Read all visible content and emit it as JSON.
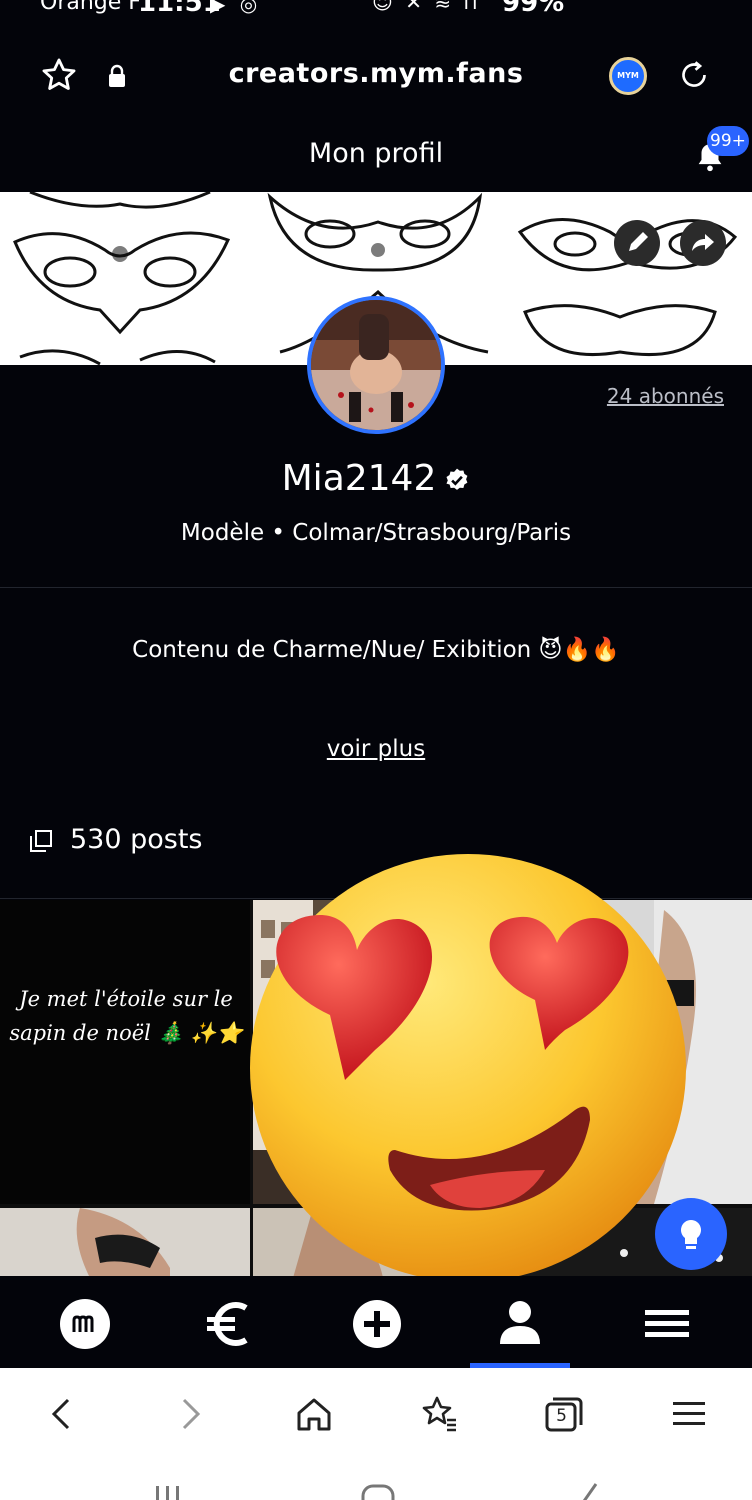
{
  "status_bar": {
    "carrier": "Orange F",
    "time": "11:51",
    "battery": "99%"
  },
  "browser": {
    "url": "creators.mym.fans",
    "ext_badge": "MYM"
  },
  "header": {
    "title": "Mon profil",
    "notification_count": "99+"
  },
  "profile": {
    "followers": "24 abonnés",
    "name": "Mia2142",
    "subtitle": "Modèle • Colmar/Strasbourg/Paris",
    "bio": "Contenu de Charme/Nue/ Exibition 😈🔥🔥",
    "see_more": "voir plus",
    "posts_count": "530 posts"
  },
  "grid": {
    "first_post_caption": "Je met l'étoile sur le sapin de noël 🎄 ✨⭐"
  },
  "colors": {
    "background": "#03040a",
    "accent": "#2a64ff",
    "badge": "#2a64ff"
  },
  "icons": {
    "app_nav": [
      "mym-home-icon",
      "euro-icon",
      "plus-icon",
      "profile-icon",
      "menu-icon"
    ],
    "browser_toolbar": [
      "back-icon",
      "forward-icon",
      "home-icon",
      "bookmarks-icon",
      "tabs-icon",
      "menu-icon"
    ],
    "tabs_count": "5"
  }
}
